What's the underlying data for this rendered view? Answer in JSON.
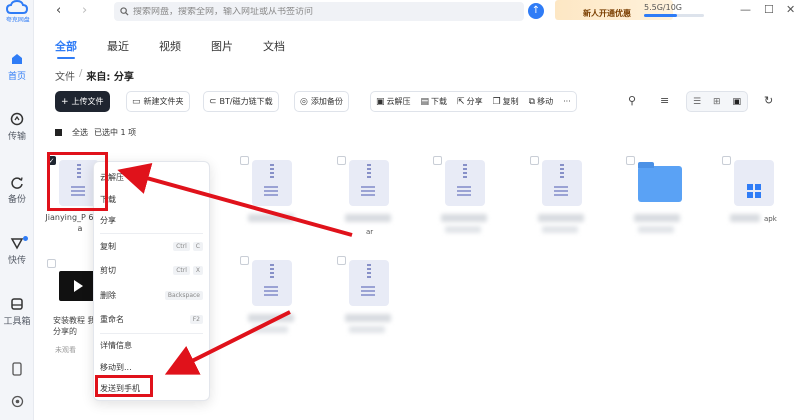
{
  "app": {
    "logo_text": "夸克网盘",
    "brand_color": "#2f7cf6"
  },
  "sidebar": {
    "items": [
      {
        "label": "首页",
        "icon": "home-icon",
        "active": true
      },
      {
        "label": "传输",
        "icon": "transfer-icon"
      },
      {
        "label": "备份",
        "icon": "backup-icon"
      },
      {
        "label": "快传",
        "icon": "quick-send-icon"
      },
      {
        "label": "工具箱",
        "icon": "toolbox-icon"
      }
    ],
    "bottom_icons": [
      "phone-icon",
      "settings-icon"
    ]
  },
  "topbar": {
    "back_icon": "chevron-left-icon",
    "forward_icon": "chevron-right-icon",
    "search_placeholder": "搜索网盘，搜索全网，输入网址或从书签访问",
    "vip_label": "新人开通优惠",
    "storage_text": "5.5G/10G",
    "storage_fraction": 0.55
  },
  "tabs": [
    "全部",
    "最近",
    "视频",
    "图片",
    "文档"
  ],
  "breadcrumb": {
    "root": "文件",
    "separator": "/",
    "current": "来自: 分享"
  },
  "toolbar": {
    "upload": "上传文件",
    "new_folder": "新建文件夹",
    "bt": "BT/磁力链下载",
    "add_backup": "添加备份",
    "group": [
      "云解压",
      "下载",
      "分享",
      "复制",
      "移动"
    ],
    "more": "···"
  },
  "selection": {
    "select_all": "全选",
    "selected_text": "已选中 1 项"
  },
  "files": [
    {
      "name": "Jianying_P 6.0.1.ra",
      "type": "zip",
      "checked": true
    },
    {
      "name": "",
      "type": "zip"
    },
    {
      "name": "ar",
      "type": "zip"
    },
    {
      "name": "",
      "type": "zip"
    },
    {
      "name": "",
      "type": "zip"
    },
    {
      "name": "",
      "type": "folder"
    },
    {
      "name": "apk",
      "type": "apk"
    },
    {
      "name": "安装教程 我分享的",
      "sub": "未观看",
      "type": "video"
    },
    {
      "name": "",
      "type": "zip"
    },
    {
      "name": "",
      "type": "zip"
    }
  ],
  "context_menu": {
    "items": [
      {
        "label": "云解压"
      },
      {
        "label": "下载"
      },
      {
        "label": "分享"
      },
      {
        "label": "复制",
        "keys": [
          "Ctrl",
          "C"
        ]
      },
      {
        "label": "剪切",
        "keys": [
          "Ctrl",
          "X"
        ]
      },
      {
        "label": "删除",
        "keys": [
          "Backspace"
        ]
      },
      {
        "label": "重命名",
        "keys": [
          "F2"
        ]
      },
      {
        "label": "详情信息"
      },
      {
        "label": "移动到..."
      },
      {
        "label": "发送到手机"
      }
    ]
  },
  "annotation_color": "#e0121b"
}
